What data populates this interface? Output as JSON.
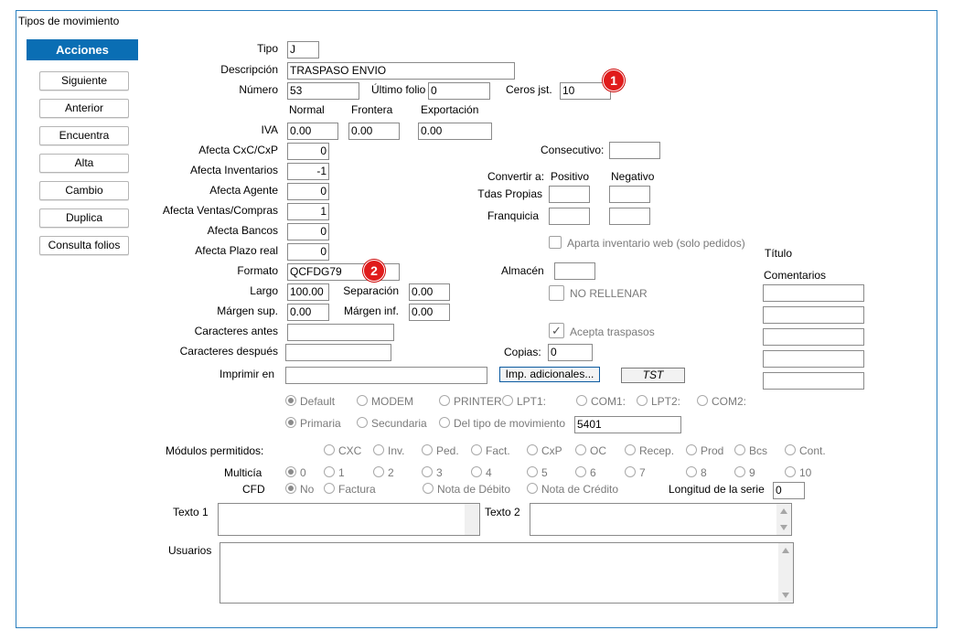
{
  "window": {
    "title": "Tipos de movimiento"
  },
  "actions": {
    "header": "Acciones",
    "buttons": [
      "Siguiente",
      "Anterior",
      "Encuentra",
      "Alta",
      "Cambio",
      "Duplica",
      "Consulta folios"
    ]
  },
  "form": {
    "tipo": {
      "label": "Tipo",
      "value": "J"
    },
    "descripcion": {
      "label": "Descripción",
      "value": "TRASPASO ENVIO"
    },
    "numero": {
      "label": "Número",
      "value": "53"
    },
    "ultimo_folio": {
      "label": "Último folio",
      "value": "0"
    },
    "ceros": {
      "label": "Ceros jst.",
      "value": "10"
    },
    "col_headers": {
      "normal": "Normal",
      "frontera": "Frontera",
      "exportacion": "Exportación"
    },
    "iva": {
      "label": "IVA",
      "normal": "0.00",
      "frontera": "0.00",
      "exportacion": "0.00"
    },
    "afecta": [
      {
        "label": "Afecta  CxC/CxP",
        "value": "0"
      },
      {
        "label": "Afecta  Inventarios",
        "value": "-1"
      },
      {
        "label": "Afecta  Agente",
        "value": "0"
      },
      {
        "label": "Afecta  Ventas/Compras",
        "value": "1"
      },
      {
        "label": "Afecta  Bancos",
        "value": "0"
      },
      {
        "label": "Afecta  Plazo real",
        "value": "0"
      }
    ],
    "formato": {
      "label": "Formato",
      "value": "QCFDG79"
    },
    "largo": {
      "label": "Largo",
      "value": "100.00"
    },
    "separacion": {
      "label": "Separación",
      "value": "0.00"
    },
    "margen_sup": {
      "label": "Márgen sup.",
      "value": "0.00"
    },
    "margen_inf": {
      "label": "Márgen inf.",
      "value": "0.00"
    },
    "caracteres_antes": {
      "label": "Caracteres antes",
      "value": ""
    },
    "caracteres_despues": {
      "label": "Caracteres después",
      "value": ""
    },
    "imprimir_en": {
      "label": "Imprimir en",
      "value": ""
    },
    "imp_adicionales": "Imp. adicionales...",
    "tst": "TST",
    "consecutivo": {
      "label": "Consecutivo:",
      "value": ""
    },
    "convertir": {
      "label": "Convertir a:",
      "positivo": "Positivo",
      "negativo": "Negativo"
    },
    "tdas_propias": {
      "label": "Tdas Propias"
    },
    "franquicia": {
      "label": "Franquicia"
    },
    "aparta": "Aparta inventario web (solo pedidos)",
    "almacen": {
      "label": "Almacén",
      "value": ""
    },
    "no_rellenar": "NO RELLENAR",
    "acepta_traspasos": "Acepta traspasos",
    "copias": {
      "label": "Copias:",
      "value": "0"
    },
    "titulo": "Título",
    "comentarios": "Comentarios",
    "ports": [
      "Default",
      "MODEM",
      "PRINTER",
      "LPT1:",
      "COM1:",
      "LPT2:",
      "COM2:"
    ],
    "tray": [
      "Primaria",
      "Secundaria",
      "Del tipo de movimiento"
    ],
    "tray_value": "5401",
    "modulos": {
      "label": "Módulos permitidos:",
      "items": [
        "CXC",
        "Inv.",
        "Ped.",
        "Fact.",
        "CxP",
        "OC",
        "Recep.",
        "Prod",
        "Bcs",
        "Cont."
      ]
    },
    "multicia": {
      "label": "Multicía",
      "items": [
        "0",
        "1",
        "2",
        "3",
        "4",
        "5",
        "6",
        "7",
        "8",
        "9",
        "10"
      ]
    },
    "cfd": {
      "label": "CFD",
      "items": [
        "No",
        "Factura",
        "Nota de Débito",
        "Nota de Crédito"
      ]
    },
    "longitud_serie": {
      "label": "Longitud de la serie",
      "value": "0"
    },
    "texto1": "Texto 1",
    "texto2": "Texto 2",
    "usuarios": "Usuarios"
  },
  "badges": [
    "1",
    "2"
  ]
}
